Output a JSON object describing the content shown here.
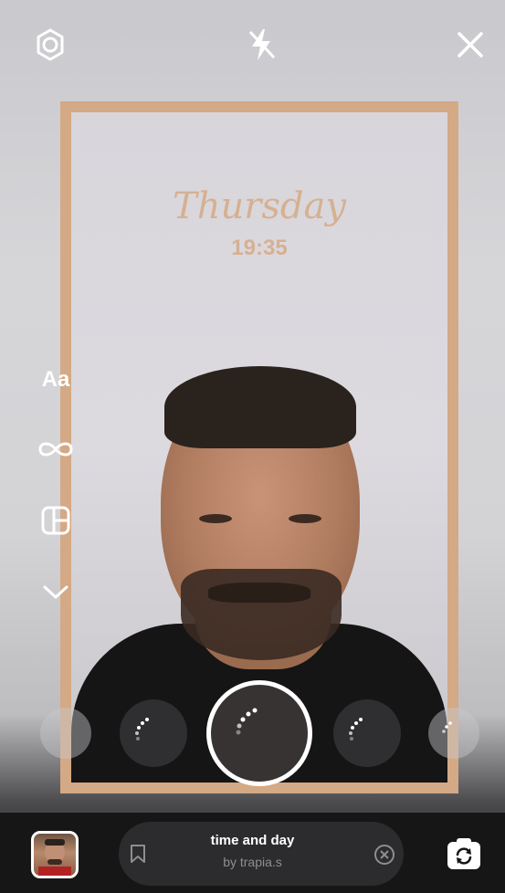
{
  "overlay": {
    "day_text": "Thursday",
    "time_text": "19:35",
    "frame_color": "#d4a985",
    "text_color": "#d6b092"
  },
  "top_bar": {
    "icons": [
      "settings-icon",
      "flash-off-icon",
      "close-icon"
    ]
  },
  "side_tools": {
    "text_tool_label": "Aa",
    "icons": [
      "boomerang-icon",
      "layout-icon",
      "chevron-down-icon"
    ]
  },
  "effect": {
    "title": "time and day",
    "author": "by trapia.s"
  },
  "bottom_bar": {
    "icons": [
      "bookmark-icon",
      "close-circle-icon",
      "flip-camera-icon"
    ]
  }
}
